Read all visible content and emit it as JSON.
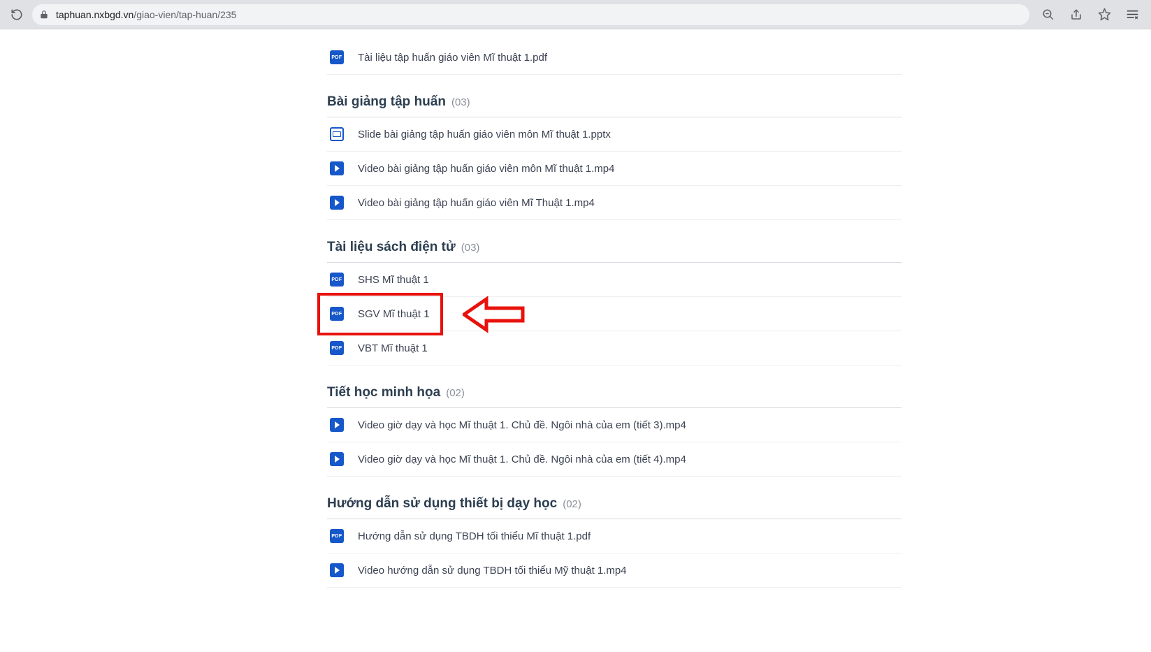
{
  "browser": {
    "url_host": "taphuan.nxbgd.vn",
    "url_path": "/giao-vien/tap-huan/235"
  },
  "sections": [
    {
      "title": "",
      "count": "",
      "items": [
        {
          "icon": "pdf",
          "name": "Tài liệu tập huấn giáo viên Mĩ thuật 1.pdf"
        }
      ]
    },
    {
      "title": "Bài giảng tập huấn",
      "count": "(03)",
      "items": [
        {
          "icon": "pptx",
          "name": "Slide bài giảng tập huấn giáo viên môn Mĩ thuật 1.pptx"
        },
        {
          "icon": "video",
          "name": "Video bài giảng tập huấn giáo viên môn Mĩ thuật 1.mp4"
        },
        {
          "icon": "video",
          "name": "Video bài giảng tập huấn giáo viên Mĩ Thuật 1.mp4"
        }
      ]
    },
    {
      "title": "Tài liệu sách điện tử",
      "count": "(03)",
      "items": [
        {
          "icon": "pdf",
          "name": "SHS Mĩ thuật 1"
        },
        {
          "icon": "pdf",
          "name": "SGV Mĩ thuật 1"
        },
        {
          "icon": "pdf",
          "name": "VBT Mĩ thuật 1"
        }
      ]
    },
    {
      "title": "Tiết học minh họa",
      "count": "(02)",
      "items": [
        {
          "icon": "video",
          "name": "Video giờ dạy và học Mĩ thuật 1. Chủ đề. Ngôi nhà của em (tiết 3).mp4"
        },
        {
          "icon": "video",
          "name": "Video giờ dạy và học Mĩ thuật 1. Chủ đề. Ngôi nhà của em (tiết 4).mp4"
        }
      ]
    },
    {
      "title": "Hướng dẫn sử dụng thiết bị dạy học",
      "count": "(02)",
      "items": [
        {
          "icon": "pdf",
          "name": "Hướng dẫn sử dụng TBDH tối thiểu Mĩ thuật 1.pdf"
        },
        {
          "icon": "video",
          "name": "Video hướng dẫn sử dụng TBDH tối thiểu Mỹ thuật 1.mp4"
        }
      ]
    }
  ],
  "highlight": {
    "section": 2,
    "item": 1
  }
}
